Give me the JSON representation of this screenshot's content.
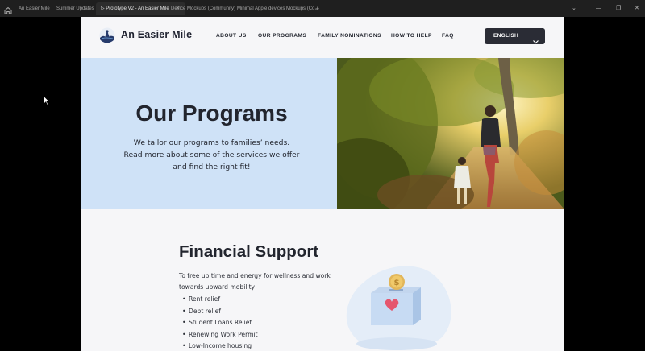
{
  "browser": {
    "tabs": [
      {
        "label": "An Easier Mile"
      },
      {
        "label": "Summer Updates"
      },
      {
        "label": "Prototype V2 - An Easier Mile",
        "active": true
      },
      {
        "label": "Device Mockups (Community)"
      },
      {
        "label": "Minimal Apple devices Mockups (Co..."
      }
    ],
    "new_tab": "+",
    "window_controls": {
      "restore_down": "⌄",
      "minimize": "—",
      "maximize": "❐",
      "close": "✕"
    }
  },
  "site": {
    "brand": "An Easier Mile",
    "nav": [
      "ABOUT US",
      "OUR PROGRAMS",
      "FAMILY NOMINATIONS",
      "HOW TO HELP",
      "FAQ"
    ],
    "language": {
      "label": "ENGLISH",
      "flag_icon": "us-flag-icon"
    }
  },
  "hero": {
    "title": "Our Programs",
    "description_lines": [
      "We tailor our programs to families’ needs.",
      "Read more about some of the services we offer",
      "and find the right fit!"
    ]
  },
  "financial": {
    "title": "Financial Support",
    "description_lines": [
      "To free up time and energy for wellness and work",
      "towards upward mobility"
    ],
    "items": [
      "Rent relief",
      "Debt relief",
      "Student Loans Relief",
      "Renewing Work Permit",
      "Low-Income housing"
    ],
    "illustration": {
      "coin_symbol": "$"
    }
  },
  "colors": {
    "hero_bg": "#cfe2f7",
    "frame_bg": "#f6f6f8",
    "lang_btn": "#2a2c35",
    "text_dark": "#22252e",
    "heart": "#e5566e",
    "coin": "#e2b65a"
  }
}
